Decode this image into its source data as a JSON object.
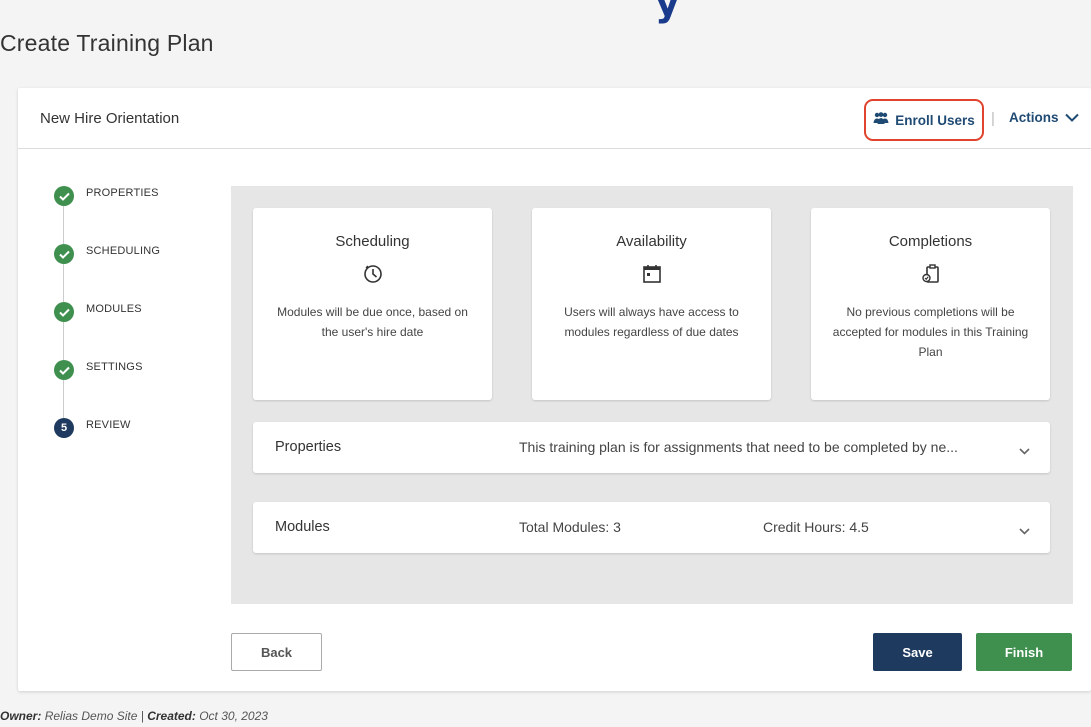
{
  "page": {
    "title": "Create Training Plan"
  },
  "header": {
    "plan_name": "New Hire Orientation",
    "enroll_label": "Enroll Users",
    "separator": "|",
    "actions_label": "Actions"
  },
  "steps": [
    {
      "label": "PROPERTIES",
      "state": "complete",
      "icon": "check-icon"
    },
    {
      "label": "SCHEDULING",
      "state": "complete",
      "icon": "check-icon"
    },
    {
      "label": "MODULES",
      "state": "complete",
      "icon": "check-icon"
    },
    {
      "label": "SETTINGS",
      "state": "complete",
      "icon": "check-icon"
    },
    {
      "label": "REVIEW",
      "state": "current",
      "number": "5"
    }
  ],
  "summary": {
    "scheduling": {
      "title": "Scheduling",
      "icon": "clock-icon",
      "text": "Modules will be due once, based on the user's hire date"
    },
    "availability": {
      "title": "Availability",
      "icon": "calendar-icon",
      "text": "Users will always have access to modules regardless of due dates"
    },
    "completions": {
      "title": "Completions",
      "icon": "clipboard-check-icon",
      "text": "No previous completions will be accepted for modules in this Training Plan"
    }
  },
  "accordions": {
    "properties": {
      "title": "Properties",
      "text": "This training plan is for assignments that need to be completed by ne..."
    },
    "modules": {
      "title": "Modules",
      "total": "Total Modules: 3",
      "credit": "Credit Hours: 4.5"
    }
  },
  "buttons": {
    "back": "Back",
    "save": "Save",
    "finish": "Finish"
  },
  "footer": {
    "owner_label": "Owner:",
    "owner_value": "Relias Demo Site |",
    "created_label": "Created:",
    "created_value": "Oct 30, 2023"
  },
  "colors": {
    "complete": "#3f8f4e",
    "current": "#1e3a5f",
    "link": "#1f4a73",
    "highlight": "#e0432e"
  }
}
